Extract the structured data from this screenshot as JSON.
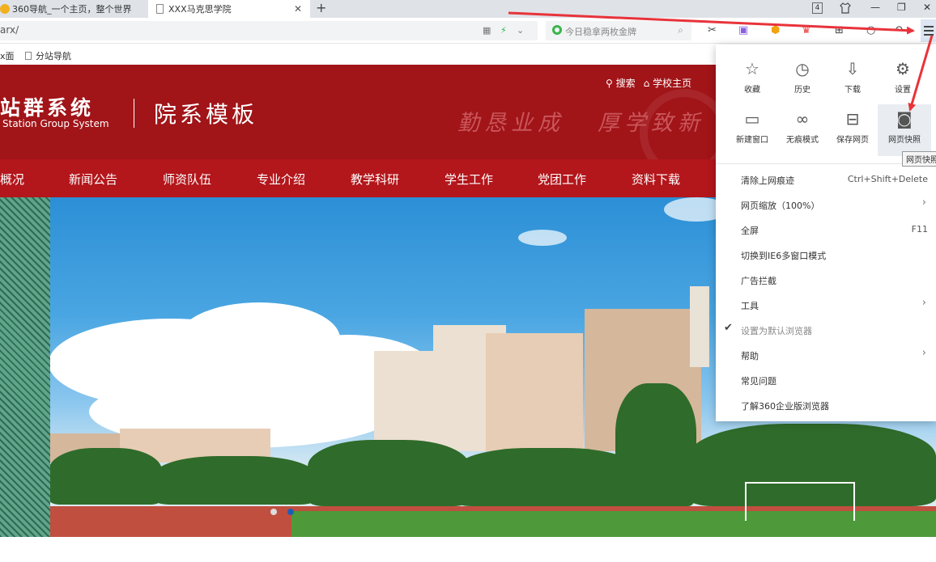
{
  "tabs": [
    {
      "title": "360导航_一个主页，整个世界"
    },
    {
      "title": "XXX马克思学院",
      "close": "✕"
    }
  ],
  "new_tab": "+",
  "window": {
    "tab_count": "4",
    "minimize": "—",
    "restore": "❐",
    "close": "✕"
  },
  "address": {
    "url": "arx/"
  },
  "search": {
    "placeholder": "今日稳拿两枚金牌"
  },
  "bookmarks": [
    {
      "label": "x面"
    },
    {
      "label": "分站导航"
    }
  ],
  "site": {
    "brand_cn": "站群系统",
    "brand_en": "Station Group System",
    "template": "院系模板",
    "top_links": [
      "搜索",
      "学校主页"
    ],
    "motto": [
      "勤恳业成",
      "厚学致新"
    ],
    "nav": [
      "概况",
      "新闻公告",
      "师资队伍",
      "专业介绍",
      "教学科研",
      "学生工作",
      "党团工作",
      "资料下载"
    ]
  },
  "menu": {
    "grid": [
      {
        "label": "收藏",
        "icon": "star-icon"
      },
      {
        "label": "历史",
        "icon": "clock-icon"
      },
      {
        "label": "下载",
        "icon": "download-icon"
      },
      {
        "label": "设置",
        "icon": "gear-icon"
      },
      {
        "label": "新建窗口",
        "icon": "window-icon"
      },
      {
        "label": "无痕模式",
        "icon": "incognito-icon"
      },
      {
        "label": "保存网页",
        "icon": "save-icon"
      },
      {
        "label": "网页快照",
        "icon": "camera-icon"
      }
    ],
    "tooltip": "网页快照",
    "items": [
      {
        "label": "清除上网痕迹",
        "shortcut": "Ctrl+Shift+Delete"
      },
      {
        "label": "网页缩放（100%）",
        "chevron": "›"
      },
      {
        "label": "全屏",
        "shortcut": "F11"
      },
      {
        "label": "切换到IE6多窗口模式"
      },
      {
        "label": "广告拦截"
      },
      {
        "label": "工具",
        "chevron": "›"
      },
      {
        "label": "设置为默认浏览器",
        "check": "✔"
      },
      {
        "label": "帮助",
        "chevron": "›"
      },
      {
        "label": "常见问题"
      },
      {
        "label": "了解360企业版浏览器"
      }
    ]
  },
  "colors": {
    "header_red": "#a11418",
    "nav_red": "#b3161b",
    "annotation_arrow": "#e8333a"
  }
}
